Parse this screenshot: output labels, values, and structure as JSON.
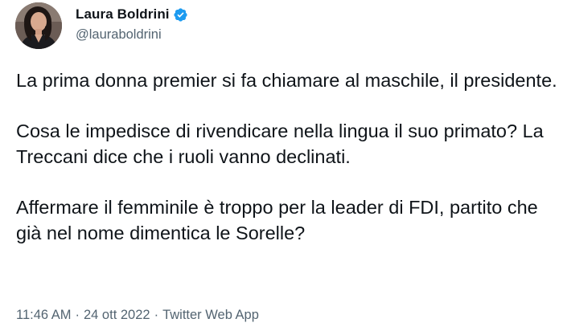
{
  "author": {
    "display_name": "Laura Boldrini",
    "handle": "@lauraboldrini",
    "verified": true,
    "verified_color": "#1d9bf0"
  },
  "tweet": {
    "paragraphs": [
      "La prima donna premier si fa chiamare al maschile, il presidente.",
      "Cosa le impedisce di rivendicare nella lingua il suo primato? La Treccani dice che i ruoli vanno declinati.",
      "Affermare il femminile è troppo per la leader di FDI, partito che già nel nome dimentica le Sorelle?"
    ]
  },
  "meta": {
    "time": "11:46 AM",
    "separator": "·",
    "date": "24 ott 2022",
    "source": "Twitter Web App"
  },
  "colors": {
    "text_primary": "#0f1419",
    "text_secondary": "#536471",
    "background": "#ffffff"
  }
}
